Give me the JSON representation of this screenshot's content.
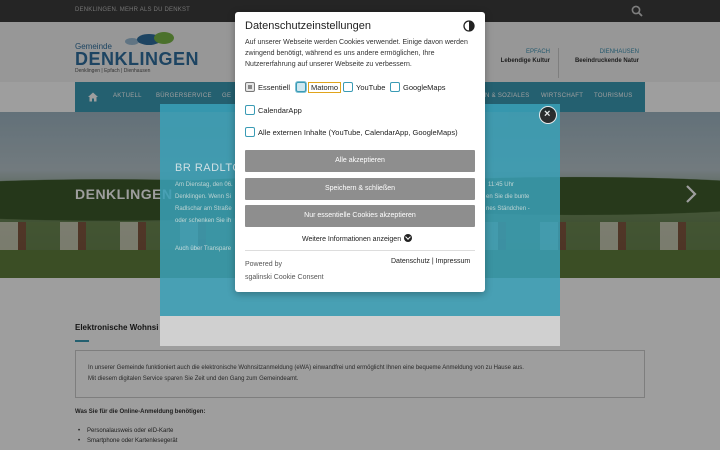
{
  "topbar": {
    "slogan": "DENKLINGEN. MEHR ALS DU DENKST"
  },
  "logo": {
    "small": "Gemeinde",
    "big": "DENKLINGEN",
    "sub": "Denklingen | Epfach | Dienhausen"
  },
  "teasers": [
    {
      "k": "EPFACH",
      "v": "Lebendige Kultur"
    },
    {
      "k": "DIENHAUSEN",
      "v": "Beeindruckende Natur"
    }
  ],
  "nav": {
    "items": [
      "AKTUELL",
      "BÜRGERSERVICE",
      "GE",
      "N & SOZIALES",
      "WIRTSCHAFT",
      "TOURISMUS"
    ]
  },
  "hero": {
    "title": "DENKLINGEN"
  },
  "bgmodal": {
    "heading": "BR RADLTOU",
    "line1": "Am Dienstag, den 06.",
    "line2": "Denklingen. Wenn Si",
    "line3": "Radlschar am Straße",
    "line4": "oder schenken Sie ih",
    "line5": "Auch über Transpare",
    "r1": "11:45 Uhr",
    "r2": "en Sie die bunte",
    "r3": "nes Ständchen -"
  },
  "content": {
    "title": "Elektronische Wohnsi",
    "info1": "In unserer Gemeinde funktioniert auch die elektronische Wohnsitzanmeldung (eWA) einwandfrei und ermöglicht Ihnen eine bequeme Anmeldung von zu Hause aus.",
    "info2": "Mit diesem digitalen Service sparen Sie Zeit und den Gang zum Gemeindeamt.",
    "need": "Was Sie für die Online-Anmeldung benötigen:",
    "bullets": [
      "Personalausweis oder eID-Karte",
      "Smartphone oder Kartenlesegerät"
    ]
  },
  "cookie": {
    "title": "Datenschutzeinstellungen",
    "description": "Auf unserer Webseite werden Cookies verwendet. Einige davon werden zwingend benötigt, während es uns andere ermöglichen, Ihre Nutzererfahrung auf unserer Webseite zu verbessern.",
    "options": {
      "essentiell": "Essentiell",
      "matomo": "Matomo",
      "youtube": "YouTube",
      "googlemaps": "GoogleMaps",
      "calendarapp": "CalendarApp",
      "all_external": "Alle externen Inhalte (YouTube, CalendarApp, GoogleMaps)"
    },
    "buttons": {
      "accept_all": "Alle akzeptieren",
      "save_close": "Speichern & schließen",
      "essential_only": "Nur essentielle Cookies akzeptieren"
    },
    "more_info": "Weitere Informationen anzeigen",
    "powered_line1": "Powered by",
    "powered_line2": "sgalinski Cookie Consent",
    "links": "Datenschutz | Impressum"
  },
  "colors": {
    "teal": "#3a9bb5",
    "button_gray": "#8e8e8e",
    "topbar": "#3d3d3d"
  }
}
